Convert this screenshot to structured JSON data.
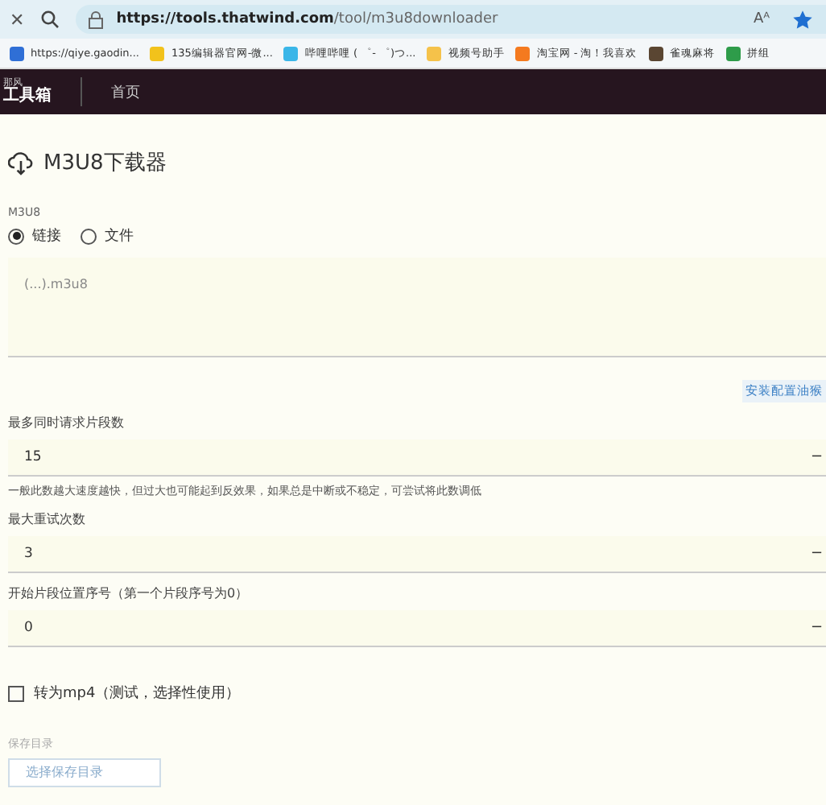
{
  "browser": {
    "url_host": "https://tools.thatwind.com",
    "url_path": "/tool/m3u8downloader",
    "read_aloud": "Aᴬ",
    "close": "✕"
  },
  "bookmarks": [
    {
      "label": "https://qiye.gaodin...",
      "color": "#2f6fd6"
    },
    {
      "label": "135编辑器官网-微...",
      "color": "#f2c21b"
    },
    {
      "label": "哔哩哔哩 ( ゜- ゜)つ...",
      "color": "#3ab6e8"
    },
    {
      "label": "视频号助手",
      "color": "#f5c24a"
    },
    {
      "label": "淘宝网 - 淘！我喜欢",
      "color": "#f47a1f"
    },
    {
      "label": "雀魂麻将",
      "color": "#5a4632"
    },
    {
      "label": "拼组",
      "color": "#2e9c4a"
    }
  ],
  "nav": {
    "logo_small": "那风",
    "logo": "工具箱",
    "items": [
      {
        "label": "首页",
        "selected": false
      }
    ]
  },
  "page": {
    "title": "M3U8下载器",
    "source_label": "M3U8",
    "sources": [
      {
        "label": "链接",
        "selected": true
      },
      {
        "label": "文件",
        "selected": false
      }
    ],
    "url_placeholder": "(...).m3u8",
    "script_link": "安装配置油猴",
    "fields": [
      {
        "label": "最多同时请求片段数",
        "value": "15",
        "step": "−",
        "hint": "一般此数越大速度越快，但过大也可能起到反效果，如果总是中断或不稳定，可尝试将此数调低"
      },
      {
        "label": "最大重试次数",
        "value": "3",
        "step": "−"
      },
      {
        "label": "开始片段位置序号（第一个片段序号为0）",
        "value": "0",
        "step": "−"
      }
    ],
    "convert": {
      "label": "转为mp4（测试，选择性使用）",
      "checked": false
    },
    "save_label": "保存目录",
    "save_button": "选择保存目录"
  }
}
